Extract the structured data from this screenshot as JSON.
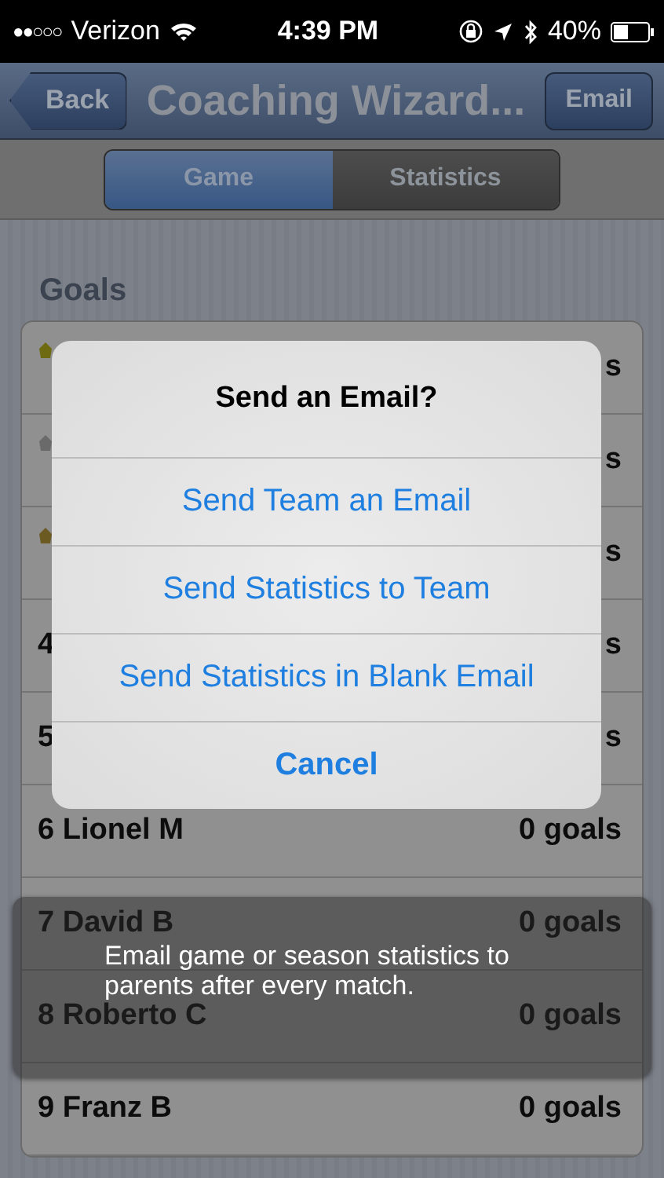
{
  "status_bar": {
    "signal": "●●○○○",
    "carrier": "Verizon",
    "time": "4:39 PM",
    "battery": "40%"
  },
  "nav_bar": {
    "back": "Back",
    "title": "Coaching Wizard...",
    "action": "Email"
  },
  "tabs": [
    {
      "label": "Game",
      "selected": true
    },
    {
      "label": "Statistics",
      "selected": false
    }
  ],
  "section": "Goals",
  "rows": [
    {
      "kind": "medal",
      "color": "#6e6a12",
      "goals": "s"
    },
    {
      "kind": "medal",
      "color": "#6a6a6a",
      "goals": "s"
    },
    {
      "kind": "medal",
      "color": "#6b5a22",
      "goals": "s"
    },
    {
      "kind": "plain",
      "label": "4",
      "goals": "s"
    },
    {
      "kind": "plain",
      "label": "5",
      "goals": "s"
    },
    {
      "kind": "plain",
      "label": "6 Lionel M",
      "goals": "0 goals"
    },
    {
      "kind": "plain",
      "label": "7 David B",
      "goals": "0 goals"
    },
    {
      "kind": "plain",
      "label": "8 Roberto C",
      "goals": "0 goals"
    },
    {
      "kind": "plain",
      "label": "9 Franz B",
      "goals": "0 goals"
    }
  ],
  "alert": {
    "title": "Send an Email?",
    "options": [
      {
        "label": "Send Team an Email",
        "kind": "option"
      },
      {
        "label": "Send Statistics to Team",
        "kind": "option"
      },
      {
        "label": "Send Statistics in Blank Email",
        "kind": "option"
      },
      {
        "label": "Cancel",
        "kind": "cancel"
      }
    ]
  },
  "caption": "Email game or season statistics to parents after every match."
}
